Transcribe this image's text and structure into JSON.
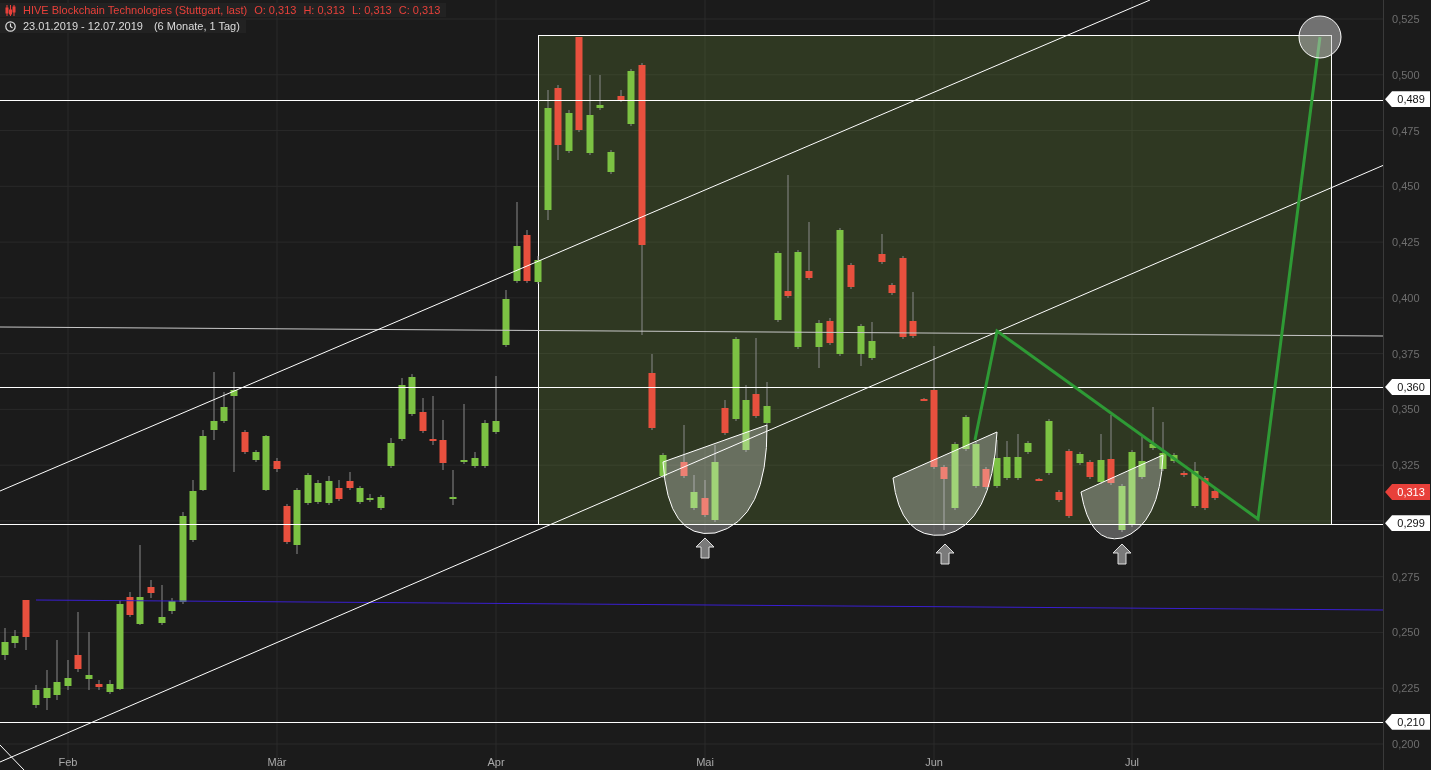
{
  "legend": {
    "title": "HIVE Blockchain Technologies (Stuttgart, last)",
    "ohlc": [
      "O: 0,313",
      "H: 0,313",
      "L: 0,313",
      "C: 0,313"
    ],
    "range": "23.01.2019 - 12.07.2019",
    "span": "(6 Monate, 1 Tag)"
  },
  "x_axis": {
    "labels": [
      "Feb",
      "Mär",
      "Apr",
      "Mai",
      "Jun",
      "Jul"
    ]
  },
  "y_axis": {
    "ticks": [
      "0,525",
      "0,500",
      "0,475",
      "0,450",
      "0,425",
      "0,400",
      "0,375",
      "0,350",
      "0,325",
      "0,275",
      "0,250",
      "0,225",
      "0,200"
    ],
    "price_tags": [
      {
        "label": "0,489",
        "color": "#ffffff"
      },
      {
        "label": "0,360",
        "color": "#ffffff"
      },
      {
        "label": "0,313",
        "color": "#e8403a"
      },
      {
        "label": "0,299",
        "color": "#ffffff"
      },
      {
        "label": "0,210",
        "color": "#ffffff"
      }
    ]
  }
}
